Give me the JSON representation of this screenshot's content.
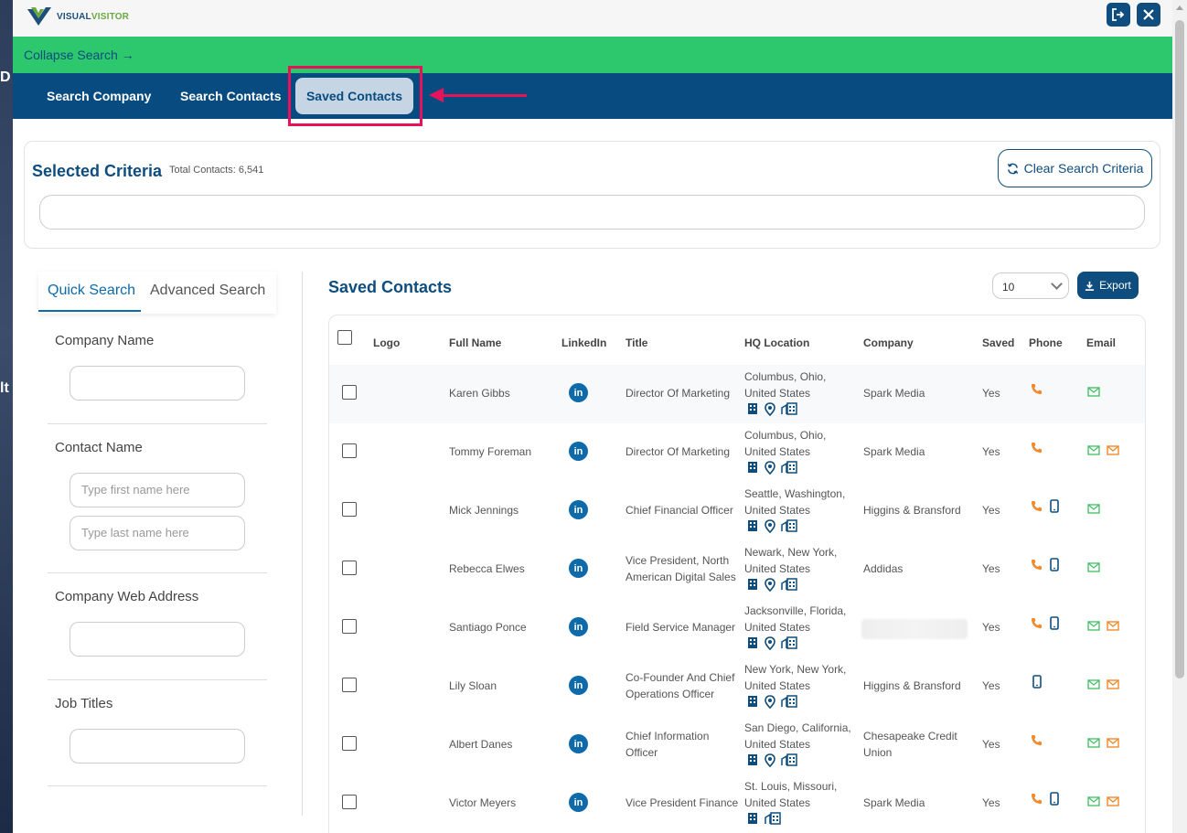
{
  "app": {
    "logo_text_1": "VISUAL",
    "logo_text_2": "VISITOR"
  },
  "background_letters": [
    "D",
    "lt"
  ],
  "topbar": {
    "logout_icon": "logout-icon",
    "close_icon": "close-icon"
  },
  "greenbar": {
    "collapse_label": "Collapse Search",
    "collapse_arrow": "→"
  },
  "nav": {
    "tab1": "Search Company",
    "tab2": "Search Contacts",
    "tab3": "Saved Contacts"
  },
  "criteria": {
    "title": "Selected Criteria",
    "total": "Total Contacts: 6,541",
    "clear_label": "Clear Search Criteria"
  },
  "left": {
    "tab_quick": "Quick Search",
    "tab_advanced": "Advanced Search",
    "company_name_label": "Company Name",
    "contact_name_label": "Contact Name",
    "first_name_placeholder": "Type first name here",
    "last_name_placeholder": "Type last name here",
    "web_label": "Company Web Address",
    "job_label": "Job Titles"
  },
  "main": {
    "title": "Saved Contacts",
    "page_size": "10",
    "export_label": "Export"
  },
  "table": {
    "headers": [
      "Logo",
      "Full Name",
      "LinkedIn",
      "Title",
      "HQ Location",
      "Company",
      "Saved",
      "Phone",
      "Email"
    ],
    "linkedin_label": "in",
    "rows": [
      {
        "name": "Karen Gibbs",
        "title": [
          "Director Of Marketing"
        ],
        "loc1": "Columbus, Ohio,",
        "loc2": "United States",
        "company": [
          "Spark Media"
        ],
        "saved": "Yes"
      },
      {
        "name": "Tommy Foreman",
        "title": [
          "Director Of Marketing"
        ],
        "loc1": "Columbus, Ohio,",
        "loc2": "United States",
        "company": [
          "Spark Media"
        ],
        "saved": "Yes"
      },
      {
        "name": "Mick Jennings",
        "title": [
          "Chief Financial Officer"
        ],
        "loc1": "Seattle, Washington,",
        "loc2": "United States",
        "company": [
          "Higgins & Bransford"
        ],
        "saved": "Yes"
      },
      {
        "name": "Rebecca Elwes",
        "title": [
          "Vice President, North",
          "American Digital Sales"
        ],
        "loc1": "Newark, New York,",
        "loc2": "United States",
        "company": [
          "Addidas"
        ],
        "saved": "Yes"
      },
      {
        "name": "Santiago Ponce",
        "title": [
          "Field Service Manager"
        ],
        "loc1": "Jacksonville, Florida,",
        "loc2": "United States",
        "company": [],
        "saved": "Yes"
      },
      {
        "name": "Lily Sloan",
        "title": [
          "Co-Founder And Chief",
          "Operations Officer"
        ],
        "loc1": "New York, New York,",
        "loc2": "United States",
        "company": [
          "Higgins & Bransford"
        ],
        "saved": "Yes"
      },
      {
        "name": "Albert Danes",
        "title": [
          "Chief Information",
          "Officer"
        ],
        "loc1": "San Diego, California,",
        "loc2": "United States",
        "company": [
          "Chesapeake Credit",
          "Union"
        ],
        "saved": "Yes"
      },
      {
        "name": "Victor Meyers",
        "title": [
          "Vice President Finance"
        ],
        "loc1": "St. Louis, Missouri,",
        "loc2": "United States",
        "company": [
          "Spark Media"
        ],
        "saved": "Yes"
      }
    ]
  },
  "colors": {
    "brand_blue": "#074b80",
    "green": "#2dc76d",
    "highlight": "#e6135a",
    "phone_orange": "#f0882d",
    "mail_green": "#4cc26c"
  }
}
